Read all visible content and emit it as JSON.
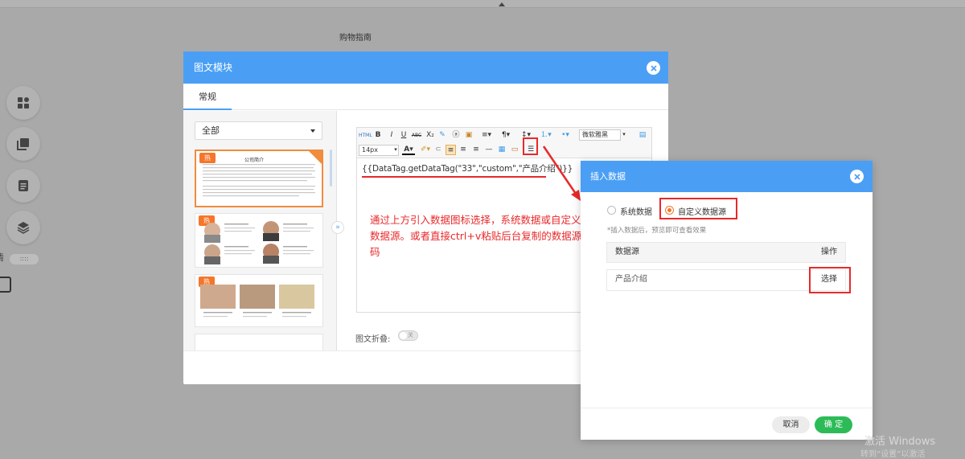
{
  "background": {
    "guide_text": "购物指南",
    "side_label": "清",
    "drag_handle": "::::",
    "side_icons": [
      "grid-icon",
      "copy-icon",
      "document-icon",
      "layers-icon"
    ]
  },
  "modal": {
    "title": "图文模块",
    "tab": "常规",
    "category_select": "全部",
    "hot_badge": "热",
    "template1_title": "公司简介",
    "editor": {
      "font_family": "微软雅黑",
      "font_size": "14px",
      "html_btn": "HTML",
      "bold": "B",
      "italic": "I",
      "underline": "U",
      "strike": "ABC",
      "content": "{{DataTag.getDataTag(\"33\",\"custom\",\"产品介绍\")}}",
      "annotation": "通过上方引入数据图标选择，系统数据或自定义数据源。或者直接ctrl+v粘贴后台复制的数据源码"
    },
    "fold_label": "图文折叠:",
    "fold_switch": "关"
  },
  "dialog": {
    "title": "插入数据",
    "radio_system": "系统数据",
    "radio_custom": "自定义数据源",
    "hint": "*插入数据后，预览即可查看效果",
    "table": {
      "columns": [
        "数据源",
        "操作"
      ],
      "rows": [
        {
          "source": "产品介绍",
          "action": "选择"
        }
      ]
    },
    "cancel": "取消",
    "ok": "确 定"
  },
  "watermark": {
    "line1": "激活 Windows",
    "line2": "转到“设置”以激活 Windows。"
  },
  "colors": {
    "accent": "#4a9ff5",
    "highlight": "#e8292b",
    "hot": "#f5762a",
    "confirm": "#2dbb58"
  }
}
